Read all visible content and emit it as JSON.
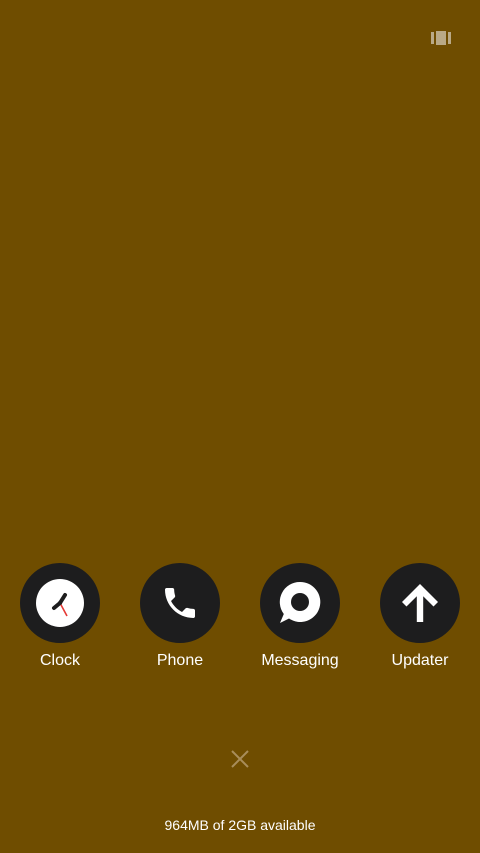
{
  "background_color": "#6f4d00",
  "view_toggle": {
    "icon": "multi-window-icon",
    "color": "#b9a986"
  },
  "apps": [
    {
      "label": "Clock",
      "icon": "clock-icon"
    },
    {
      "label": "Phone",
      "icon": "phone-icon"
    },
    {
      "label": "Messaging",
      "icon": "messaging-icon"
    },
    {
      "label": "Updater",
      "icon": "arrow-up-icon"
    }
  ],
  "clear_all": {
    "icon": "close-icon",
    "color": "#a88d5a"
  },
  "memory_status": "964MB of 2GB available"
}
